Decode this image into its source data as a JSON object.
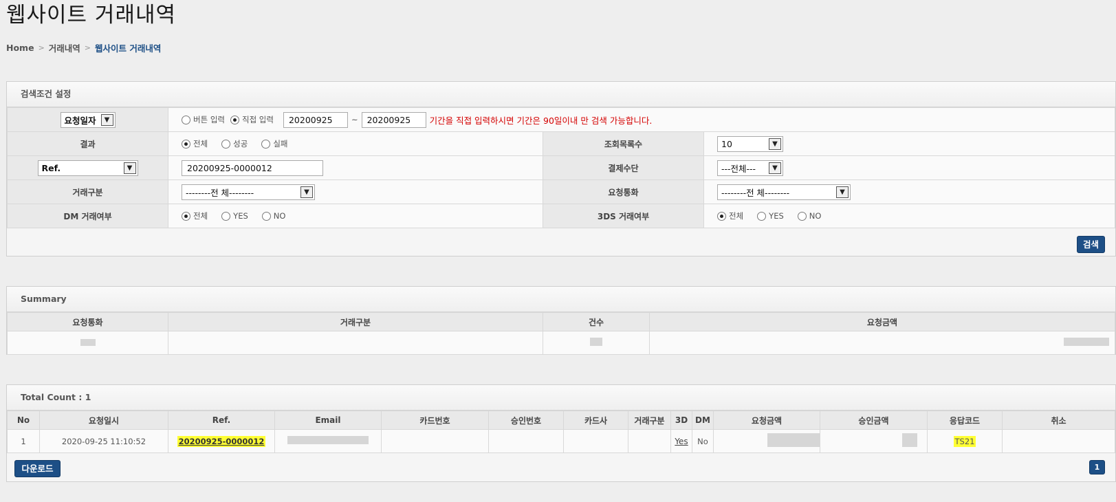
{
  "page_title": "웹사이트 거래내역",
  "breadcrumb": {
    "home": "Home",
    "level1": "거래내역",
    "current": "웹사이트 거래내역"
  },
  "search": {
    "title": "검색조건 설정",
    "date_type_select": "요청일자",
    "radio_button_input": "버튼 입력",
    "radio_direct_input": "직접 입력",
    "date_from": "20200925",
    "tilde": "~",
    "date_to": "20200925",
    "warning": "기간을 직접 입력하시면 기간은 90일이내 만 검색 가능합니다.",
    "result_label": "결과",
    "result_options": [
      "전체",
      "성공",
      "실패"
    ],
    "page_size_label": "조회목록수",
    "page_size_value": "10",
    "ref_select": "Ref.",
    "ref_value": "20200925-0000012",
    "payment_label": "결제수단",
    "payment_value": "---전체---",
    "tx_type_label": "거래구분",
    "tx_type_value": "--------전 체--------",
    "currency_label": "요청통화",
    "currency_value": "--------전 체--------",
    "dm_label": "DM 거래여부",
    "dm_options": [
      "전체",
      "YES",
      "NO"
    ],
    "ds3_label": "3DS 거래여부",
    "ds3_options": [
      "전체",
      "YES",
      "NO"
    ],
    "search_button": "검색"
  },
  "summary": {
    "title": "Summary",
    "headers": [
      "요청통화",
      "거래구분",
      "건수",
      "요청금액"
    ]
  },
  "results": {
    "total_count": "Total Count : 1",
    "headers": [
      "No",
      "요청일시",
      "Ref.",
      "Email",
      "카드번호",
      "승인번호",
      "카드사",
      "거래구분",
      "3D",
      "DM",
      "요청금액",
      "승인금액",
      "응답코드",
      "취소"
    ],
    "rows": [
      {
        "no": "1",
        "datetime": "2020-09-25 11:10:52",
        "ref": "20200925-0000012",
        "email": "",
        "card_no": "",
        "approval_no": "",
        "card_co": "",
        "tx_type": "",
        "d3": "Yes",
        "dm": "No",
        "req_amount": "",
        "appr_amount": "",
        "resp_code": "TS21",
        "cancel": ""
      }
    ],
    "download_button": "다운로드",
    "current_page": "1"
  },
  "colors": {
    "primary": "#1d4f86",
    "warning": "#d40000",
    "highlight": "#ffff33"
  }
}
